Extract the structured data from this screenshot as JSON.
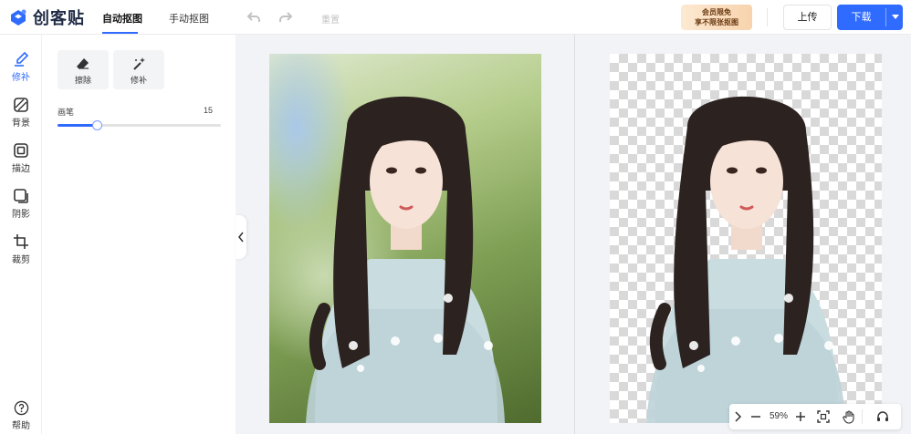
{
  "app": {
    "brand_name": "创客贴",
    "brand_color": "#2f6bff"
  },
  "header": {
    "tabs": [
      {
        "label": "自动抠图",
        "active": true
      },
      {
        "label": "手动抠图",
        "active": false
      }
    ],
    "undo_icon": "undo-icon",
    "redo_icon": "redo-icon",
    "reset_label": "重置",
    "promo_line1": "会员限免",
    "promo_line2": "享不限张抠图",
    "upload_label": "上传",
    "download_label": "下载"
  },
  "sidebar": {
    "items": [
      {
        "label": "修补",
        "icon": "brush-icon",
        "active": true
      },
      {
        "label": "背景",
        "icon": "background-icon",
        "active": false
      },
      {
        "label": "描边",
        "icon": "outline-icon",
        "active": false
      },
      {
        "label": "阴影",
        "icon": "shadow-icon",
        "active": false
      },
      {
        "label": "裁剪",
        "icon": "crop-icon",
        "active": false
      }
    ],
    "help_label": "帮助"
  },
  "tool_panel": {
    "erase_label": "擦除",
    "repair_label": "修补",
    "brush_label": "画笔",
    "brush_size": "15",
    "brush_fraction": 0.24
  },
  "zoom": {
    "value": "59%"
  }
}
